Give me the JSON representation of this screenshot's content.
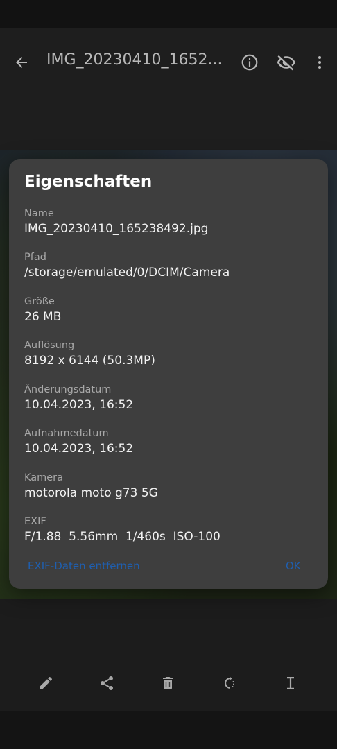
{
  "toolbar": {
    "title": "IMG_20230410_1652...",
    "back_icon": "arrow-back-icon",
    "info_icon": "info-icon",
    "hide_icon": "visibility-off-icon",
    "more_icon": "more-vert-icon"
  },
  "dialog": {
    "title": "Eigenschaften",
    "properties": [
      {
        "label": "Name",
        "value": "IMG_20230410_165238492.jpg"
      },
      {
        "label": "Pfad",
        "value": "/storage/emulated/0/DCIM/Camera"
      },
      {
        "label": "Größe",
        "value": "26 MB"
      },
      {
        "label": "Auflösung",
        "value": "8192 x 6144 (50.3MP)"
      },
      {
        "label": "Änderungsdatum",
        "value": "10.04.2023, 16:52"
      },
      {
        "label": "Aufnahmedatum",
        "value": "10.04.2023, 16:52"
      },
      {
        "label": "Kamera",
        "value": "motorola moto g73 5G"
      },
      {
        "label": "EXIF",
        "value": "F/1.88  5.56mm  1/460s  ISO-100"
      }
    ],
    "remove_exif_label": "EXIF-Daten entfernen",
    "ok_label": "OK",
    "accent_color": "#1f5fb0"
  },
  "bottom_bar": {
    "icons": [
      "edit-icon",
      "share-icon",
      "delete-icon",
      "rotate-icon",
      "rename-icon"
    ]
  }
}
